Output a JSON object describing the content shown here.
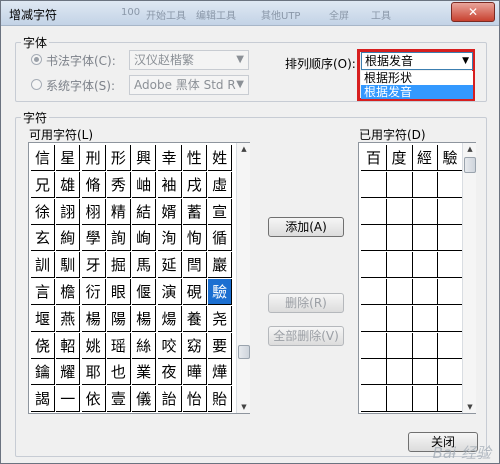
{
  "window": {
    "title": "增减字符",
    "close_label": "✕",
    "watermark": "Bai̵ 经验",
    "faint_bar": [
      "100",
      "开始工具",
      "编辑工具",
      "其他UTP",
      "全屏",
      "工具"
    ]
  },
  "font_group": {
    "label": "字体",
    "callig_label": "书法字体(C):",
    "callig_value": "汉仪赵楷繁",
    "system_label": "系统字体(S):",
    "system_value": "Adobe 黑体 Std R"
  },
  "sort": {
    "label": "排列顺序(O):",
    "value": "根据发音",
    "options": [
      "根据形状",
      "根据发音"
    ],
    "selected_index": 1
  },
  "char_group": {
    "label": "字符",
    "available_label": "可用字符(L)",
    "used_label": "已用字符(D)"
  },
  "available_chars": [
    [
      "信",
      "星",
      "刑",
      "形",
      "興",
      "幸",
      "性",
      "姓"
    ],
    [
      "兄",
      "雄",
      "脩",
      "秀",
      "岫",
      "袖",
      "戌",
      "虛"
    ],
    [
      "徐",
      "詡",
      "栩",
      "精",
      "結",
      "婿",
      "蓄",
      "宣"
    ],
    [
      "玄",
      "絢",
      "學",
      "詢",
      "峋",
      "洵",
      "恂",
      "循"
    ],
    [
      "訓",
      "馴",
      "牙",
      "掘",
      "馬",
      "延",
      "閆",
      "巖"
    ],
    [
      "言",
      "檐",
      "衍",
      "眼",
      "偃",
      "演",
      "硯",
      "驗"
    ],
    [
      "堰",
      "燕",
      "楊",
      "陽",
      "楊",
      "煬",
      "養",
      "尧"
    ],
    [
      "侥",
      "軺",
      "姚",
      "瑶",
      "絲",
      "咬",
      "窈",
      "要"
    ],
    [
      "鑰",
      "耀",
      "耶",
      "也",
      "業",
      "夜",
      "曄",
      "燁"
    ],
    [
      "謁",
      "一",
      "依",
      "壹",
      "儀",
      "詒",
      "怡",
      "貽"
    ]
  ],
  "available_selected": [
    5,
    7
  ],
  "used_chars": [
    [
      "百",
      "度",
      "經",
      "驗"
    ],
    [
      "",
      "",
      "",
      ""
    ],
    [
      "",
      "",
      "",
      ""
    ],
    [
      "",
      "",
      "",
      ""
    ],
    [
      "",
      "",
      "",
      ""
    ],
    [
      "",
      "",
      "",
      ""
    ],
    [
      "",
      "",
      "",
      ""
    ],
    [
      "",
      "",
      "",
      ""
    ],
    [
      "",
      "",
      "",
      ""
    ],
    [
      "",
      "",
      "",
      ""
    ]
  ],
  "buttons": {
    "add": "添加(A)",
    "delete": "删除(R)",
    "delete_all": "全部删除(V)",
    "close": "关闭"
  }
}
